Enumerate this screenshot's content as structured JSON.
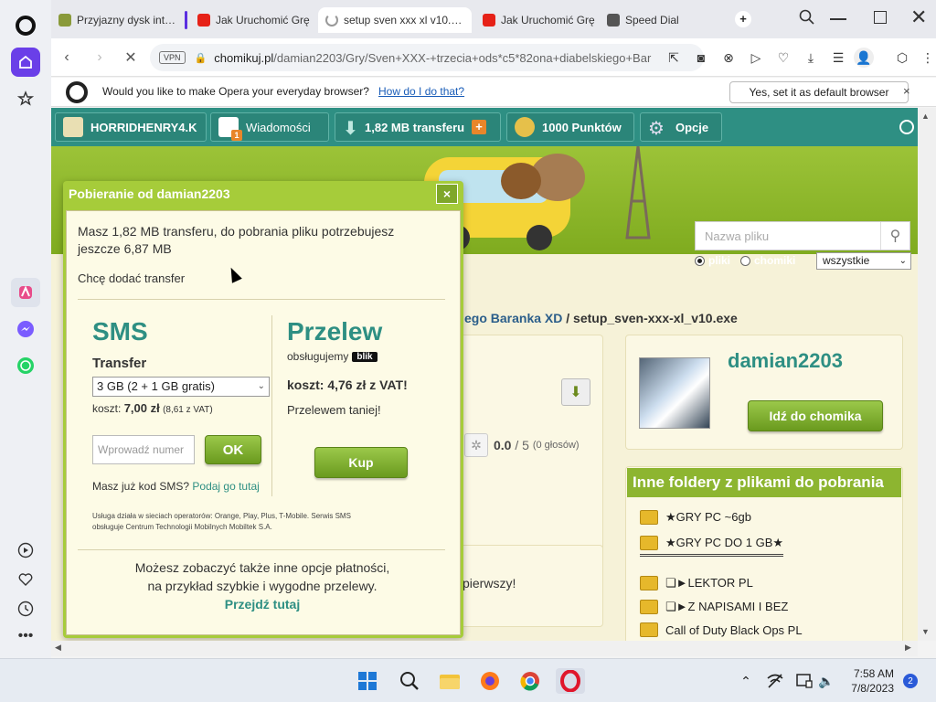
{
  "tabs": [
    {
      "label": "Przyjazny dysk intern"
    },
    {
      "label": "Jak Uruchomić Grę"
    },
    {
      "label": "setup sven xxx xl v10.exe"
    },
    {
      "label": "Jak Uruchomić Grę"
    },
    {
      "label": "Speed Dial"
    }
  ],
  "address": {
    "vpn": "VPN",
    "host": "chomikuj.pl",
    "path": "/damian2203/Gry/Sven+XXX-+trzecia+ods*c5*82ona+diabelskiego+Bar"
  },
  "default_bar": {
    "question": "Would you like to make Opera your everyday browser?",
    "link": "How do I do that?",
    "set_button": "Yes, set it as default browser",
    "close": "×"
  },
  "topnav": {
    "user": "HORRIDHENRY4.K",
    "messages": "Wiadomości",
    "messages_badge": "1",
    "transfer": "1,82 MB transferu",
    "points": "1000 Punktów",
    "options": "Opcje"
  },
  "search": {
    "placeholder": "Nazwa pliku",
    "radio_files": "pliki",
    "radio_chomiki": "chomiki",
    "category": "wszystkie"
  },
  "breadcrumb": {
    "folder": "ego Baranka XD",
    "separator": " / ",
    "current": "setup_sven-xxx-xl_v10.exe"
  },
  "rating": {
    "score": "0.0",
    "separator": "/",
    "max": "5",
    "votes": "(0 głosów)"
  },
  "first_text": "pierwszy!",
  "owner": {
    "name": "damian2203",
    "button": "Idź do chomika"
  },
  "folders": {
    "title": "Inne foldery z plikami do pobrania",
    "items": [
      {
        "label": "★GRY PC ~6gb"
      },
      {
        "label": "★GRY PC DO 1 GB★"
      },
      {
        "label": "❏►LEKTOR PL"
      },
      {
        "label": "❏►Z NAPISAMI I BEZ"
      },
      {
        "label": "Call of Duty Black Ops PL"
      }
    ]
  },
  "modal": {
    "title": "Pobieranie od damian2203",
    "close": "×",
    "intro_line1": "Masz 1,82 MB transferu, do pobrania pliku potrzebujesz",
    "intro_line2": "jeszcze 6,87 MB",
    "add_transfer": "Chcę dodać transfer",
    "sms": {
      "heading": "SMS",
      "transfer_label": "Transfer",
      "select_value": "3 GB (2 + 1 GB gratis)",
      "cost_label": "koszt:",
      "cost_value": "7,00 zł",
      "cost_vat": "(8,61 z VAT)",
      "input_placeholder": "Wprowadź numer",
      "ok_button": "OK",
      "have_code": "Masz już kod SMS?",
      "have_code_link": "Podaj go tutaj",
      "fine_print_1": "Usługa działa w sieciach operatorów: Orange, Play, Plus, T-Mobile. Serwis SMS",
      "fine_print_2": "obsługuje Centrum Technologii Mobilnych Mobiltek S.A."
    },
    "przelew": {
      "heading": "Przelew",
      "supported": "obsługujemy",
      "blik": "blik",
      "cost": "koszt: 4,76 zł z VAT!",
      "cheaper": "Przelewem taniej!",
      "buy_button": "Kup"
    },
    "footer_line1": "Możesz zobaczyć także inne opcje płatności,",
    "footer_line2": "na przykład szybkie i wygodne przelewy.",
    "footer_link": "Przejdź tutaj"
  },
  "taskbar": {
    "time": "7:58 AM",
    "date": "7/8/2023",
    "notifications": "2"
  },
  "colors": {
    "accent": "#2e8f83",
    "header_green": "#8db530",
    "opera_accent": "#6a3fe8"
  }
}
